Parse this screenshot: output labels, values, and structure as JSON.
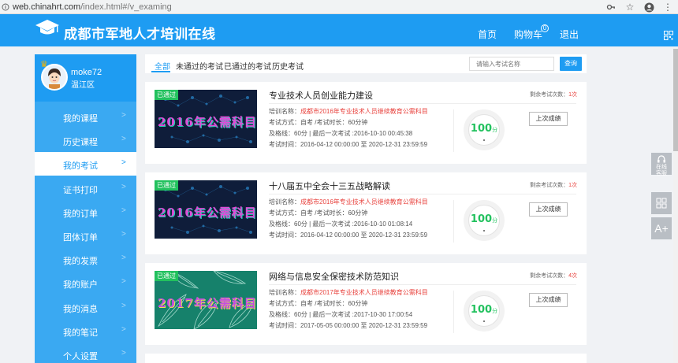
{
  "browser": {
    "url_host": "web.chinahrt.com",
    "url_path": "/index.html#/v_examing"
  },
  "header": {
    "site_title": "成都市军地人才培训在线",
    "nav_home": "首页",
    "nav_cart": "购物车",
    "cart_count": "0",
    "nav_logout": "退出"
  },
  "profile": {
    "username": "moke72",
    "location": "温江区"
  },
  "sidebar": {
    "items": [
      {
        "label": "我的课程"
      },
      {
        "label": "历史课程"
      },
      {
        "label": "我的考试"
      },
      {
        "label": "证书打印"
      },
      {
        "label": "我的订单"
      },
      {
        "label": "团体订单"
      },
      {
        "label": "我的发票"
      },
      {
        "label": "我的账户"
      },
      {
        "label": "我的消息"
      },
      {
        "label": "我的笔记"
      },
      {
        "label": "个人设置"
      }
    ],
    "chevron": ">"
  },
  "tabs": {
    "items": [
      {
        "label": "全部"
      },
      {
        "label": "未通过的考试"
      },
      {
        "label": "已通过的考试"
      },
      {
        "label": "历史考试"
      }
    ],
    "search_placeholder": "请输入考试名称",
    "search_button": "查询"
  },
  "float_bar": {
    "service_label": "在线客服",
    "font_label": "A+"
  },
  "exams": [
    {
      "thumb_text": "2016年公需科目",
      "badge": "已通过",
      "title": "专业技术人员创业能力建设",
      "remain_label": "剩余考试次数：",
      "remain_count": "1次",
      "training_label": "培训名称：",
      "training_name": "成都市2016年专业技术人员继续教育公需科目",
      "method_line": "考试方式：自考 /考试时长：60分钟",
      "pass_line": "及格线：60分 | 最后一次考试 :2016-10-10 00:45:38",
      "time_line": "考试时间：2016-04-12 00:00:00 至 2020-12-31 23:59:59",
      "score": "100",
      "score_unit": "分",
      "button": "上次成绩"
    },
    {
      "thumb_text": "2016年公需科目",
      "badge": "已通过",
      "title": "十八届五中全会十三五战略解读",
      "remain_label": "剩余考试次数：",
      "remain_count": "1次",
      "training_label": "培训名称：",
      "training_name": "成都市2016年专业技术人员继续教育公需科目",
      "method_line": "考试方式：自考 /考试时长：60分钟",
      "pass_line": "及格线：60分 | 最后一次考试 :2016-10-10 01:08:14",
      "time_line": "考试时间：2016-04-12 00:00:00 至 2020-12-31 23:59:59",
      "score": "100",
      "score_unit": "分",
      "button": "上次成绩"
    },
    {
      "thumb_text": "2017年公需科目",
      "badge": "已通过",
      "title": "网络与信息安全保密技术防范知识",
      "remain_label": "剩余考试次数：",
      "remain_count": "4次",
      "training_label": "培训名称：",
      "training_name": "成都市2017年专业技术人员继续教育公需科目",
      "method_line": "考试方式：自考 /考试时长：60分钟",
      "pass_line": "及格线：60分 | 最后一次考试 :2017-10-30 17:00:54",
      "time_line": "考试时间：2017-05-05 00:00:00 至 2020-12-31 23:59:59",
      "score": "100",
      "score_unit": "分",
      "button": "上次成绩"
    }
  ]
}
